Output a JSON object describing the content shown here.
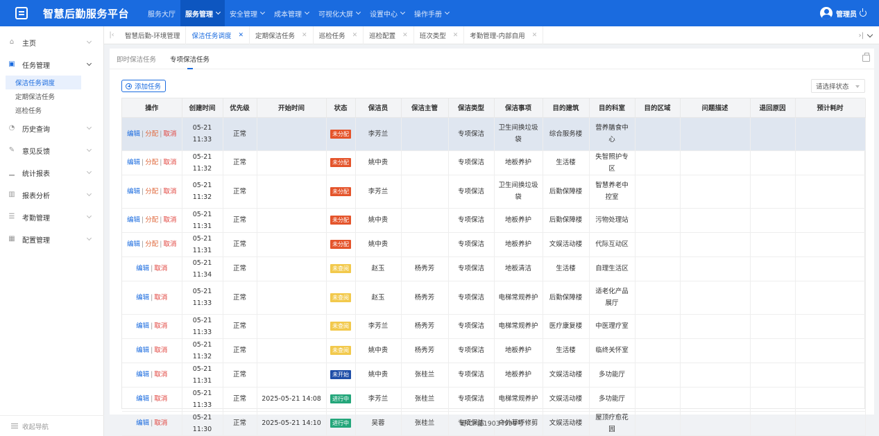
{
  "app": {
    "title": "智慧后勤服务平台"
  },
  "topnav": [
    {
      "label": "服务大厅",
      "dropdown": false,
      "active": false
    },
    {
      "label": "服务管理",
      "dropdown": true,
      "active": true
    },
    {
      "label": "安全管理",
      "dropdown": true,
      "active": false
    },
    {
      "label": "成本管理",
      "dropdown": true,
      "active": false
    },
    {
      "label": "可视化大屏",
      "dropdown": true,
      "active": false
    },
    {
      "label": "设置中心",
      "dropdown": true,
      "active": false
    },
    {
      "label": "操作手册",
      "dropdown": true,
      "active": false
    }
  ],
  "user": {
    "name": "管理员"
  },
  "sidebar": {
    "items": [
      {
        "label": "主页",
        "icon": "home-icon",
        "glyph": "⌂"
      },
      {
        "label": "任务管理",
        "icon": "task-icon",
        "glyph": "▣",
        "open": true,
        "children": [
          {
            "label": "保洁任务调度",
            "active": true
          },
          {
            "label": "定期保洁任务",
            "active": false
          },
          {
            "label": "巡检任务",
            "active": false
          }
        ]
      },
      {
        "label": "历史查询",
        "icon": "history-icon",
        "glyph": "◔"
      },
      {
        "label": "意见反馈",
        "icon": "feedback-icon",
        "glyph": "✎"
      },
      {
        "label": "统计报表",
        "icon": "stats-icon",
        "glyph": "▁"
      },
      {
        "label": "报表分析",
        "icon": "analysis-icon",
        "glyph": "▥"
      },
      {
        "label": "考勤管理",
        "icon": "attendance-icon",
        "glyph": "☰"
      },
      {
        "label": "配置管理",
        "icon": "config-icon",
        "glyph": "▦"
      }
    ],
    "collapse_label": "收起导航"
  },
  "tabs": [
    {
      "label": "智慧后勤-环境管理",
      "closable": false,
      "active": false
    },
    {
      "label": "保洁任务调度",
      "closable": true,
      "active": true
    },
    {
      "label": "定期保洁任务",
      "closable": true,
      "active": false
    },
    {
      "label": "巡检任务",
      "closable": true,
      "active": false
    },
    {
      "label": "巡检配置",
      "closable": true,
      "active": false
    },
    {
      "label": "班次类型",
      "closable": true,
      "active": false
    },
    {
      "label": "考勤管理-内部自用",
      "closable": true,
      "active": false
    }
  ],
  "subtabs": [
    {
      "label": "即时保洁任务",
      "active": false
    },
    {
      "label": "专项保洁任务",
      "active": true
    }
  ],
  "toolbar": {
    "add_label": "添加任务",
    "status_placeholder": "请选择状态"
  },
  "table": {
    "columns": [
      "操作",
      "创建时间",
      "优先级",
      "开始时间",
      "状态",
      "保洁员",
      "保洁主管",
      "保洁类型",
      "保洁事项",
      "目的建筑",
      "目的科室",
      "目的区域",
      "问题描述",
      "退回原因",
      "预计耗时"
    ],
    "action_labels": {
      "edit": "编辑",
      "assign": "分配",
      "cancel": "取消"
    },
    "status_colors": {
      "未分配": "#e4542b",
      "未查阅": "#f2c94c",
      "未开始": "#1f4fa8",
      "进行中": "#23a67a"
    },
    "rows": [
      {
        "assign": true,
        "created": "05-21 11:33",
        "priority": "正常",
        "start": "",
        "status": "未分配",
        "cleaner": "李芳兰",
        "supervisor": "",
        "type": "专项保洁",
        "item": "卫生间换垃圾袋",
        "building": "综合服务楼",
        "dept": "营养膳食中心",
        "tall": true,
        "selected": true
      },
      {
        "assign": true,
        "created": "05-21 11:32",
        "priority": "正常",
        "start": "",
        "status": "未分配",
        "cleaner": "姚中贵",
        "supervisor": "",
        "type": "专项保洁",
        "item": "地板养护",
        "building": "生活楼",
        "dept": "失智照护专区",
        "tall": false
      },
      {
        "assign": true,
        "created": "05-21 11:32",
        "priority": "正常",
        "start": "",
        "status": "未分配",
        "cleaner": "李芳兰",
        "supervisor": "",
        "type": "专项保洁",
        "item": "卫生间换垃圾袋",
        "building": "后勤保障楼",
        "dept": "智慧养老中控室",
        "tall": true
      },
      {
        "assign": true,
        "created": "05-21 11:31",
        "priority": "正常",
        "start": "",
        "status": "未分配",
        "cleaner": "姚中贵",
        "supervisor": "",
        "type": "专项保洁",
        "item": "地板养护",
        "building": "后勤保障楼",
        "dept": "污物处理站",
        "tall": false
      },
      {
        "assign": true,
        "created": "05-21 11:31",
        "priority": "正常",
        "start": "",
        "status": "未分配",
        "cleaner": "姚中贵",
        "supervisor": "",
        "type": "专项保洁",
        "item": "地板养护",
        "building": "文娱活动楼",
        "dept": "代际互动区",
        "tall": false
      },
      {
        "assign": false,
        "created": "05-21 11:34",
        "priority": "正常",
        "start": "",
        "status": "未查阅",
        "cleaner": "赵玉",
        "supervisor": "杨秀芳",
        "type": "专项保洁",
        "item": "地板清洁",
        "building": "生活楼",
        "dept": "自理生活区",
        "tall": false
      },
      {
        "assign": false,
        "created": "05-21 11:33",
        "priority": "正常",
        "start": "",
        "status": "未查阅",
        "cleaner": "赵玉",
        "supervisor": "杨秀芳",
        "type": "专项保洁",
        "item": "电梯常规养护",
        "building": "后勤保障楼",
        "dept": "适老化产品展厅",
        "tall": true
      },
      {
        "assign": false,
        "created": "05-21 11:33",
        "priority": "正常",
        "start": "",
        "status": "未查阅",
        "cleaner": "李芳兰",
        "supervisor": "杨秀芳",
        "type": "专项保洁",
        "item": "电梯常规养护",
        "building": "医疗康复楼",
        "dept": "中医理疗室",
        "tall": false
      },
      {
        "assign": false,
        "created": "05-21 11:32",
        "priority": "正常",
        "start": "",
        "status": "未查阅",
        "cleaner": "姚中贵",
        "supervisor": "杨秀芳",
        "type": "专项保洁",
        "item": "地板养护",
        "building": "生活楼",
        "dept": "临终关怀室",
        "tall": false
      },
      {
        "assign": false,
        "created": "05-21 11:31",
        "priority": "正常",
        "start": "",
        "status": "未开始",
        "cleaner": "姚中贵",
        "supervisor": "张桂兰",
        "type": "专项保洁",
        "item": "地板养护",
        "building": "文娱活动楼",
        "dept": "多功能厅",
        "tall": false
      },
      {
        "assign": false,
        "created": "05-21 11:33",
        "priority": "正常",
        "start": "2025-05-21 14:08",
        "status": "进行中",
        "cleaner": "李芳兰",
        "supervisor": "张桂兰",
        "type": "专项保洁",
        "item": "电梯常规养护",
        "building": "文娱活动楼",
        "dept": "多功能厅",
        "tall": false
      },
      {
        "assign": false,
        "created": "05-21 11:30",
        "priority": "正常",
        "start": "2025-05-21 14:10",
        "status": "进行中",
        "cleaner": "吴蓉",
        "supervisor": "张桂兰",
        "type": "专项保洁",
        "item": "户外草坪修剪",
        "building": "文娱活动楼",
        "dept": "屋顶疗愈花园",
        "tall": false
      }
    ]
  },
  "footer": {
    "icp": "蜀ICP备19034998号"
  }
}
